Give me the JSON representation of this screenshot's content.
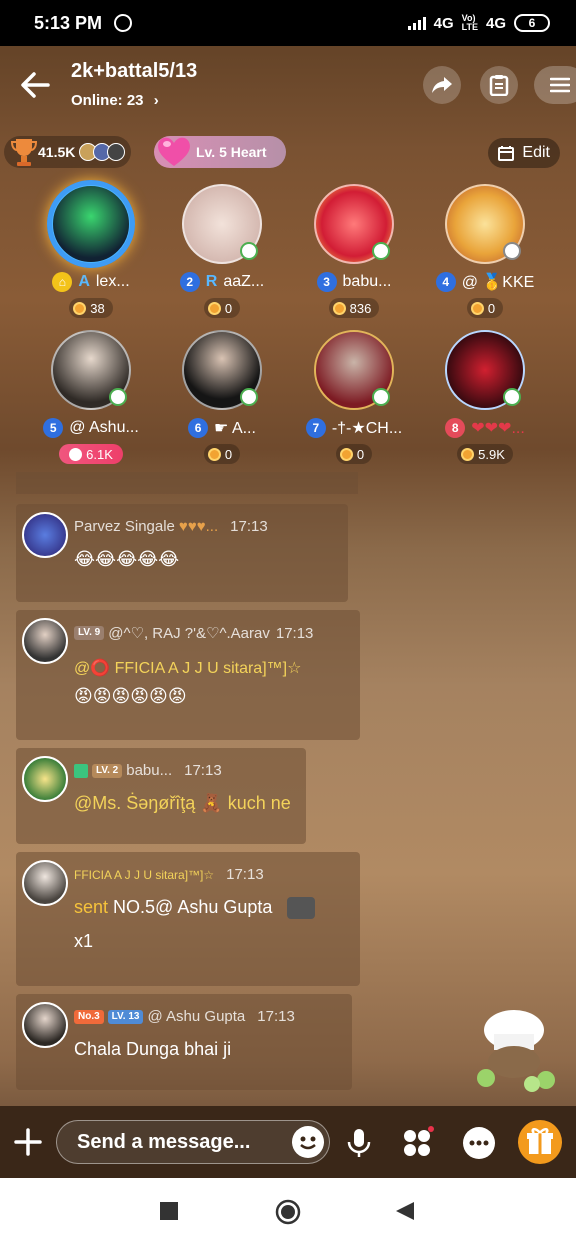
{
  "status_bar": {
    "time": "5:13 PM",
    "network_1": "4G",
    "network_2": "4G",
    "battery": "6"
  },
  "header": {
    "title": "2k+battal5/13",
    "online_label": "Online: 23",
    "icons": [
      "back-arrow-icon",
      "share-icon",
      "clipboard-icon",
      "menu-icon"
    ]
  },
  "stats": {
    "trophy_count": "41.5K",
    "heart_level": "Lv. 5 Heart",
    "edit_label": "Edit"
  },
  "seats": [
    {
      "num": "",
      "name": "lex...",
      "prefix": "A",
      "points": "38",
      "host": true
    },
    {
      "num": "2",
      "name": "aaZ...",
      "prefix": "R",
      "points": "0"
    },
    {
      "num": "3",
      "name": "babu...",
      "prefix": "",
      "points": "836"
    },
    {
      "num": "4",
      "name": "@ 🥇KKE",
      "prefix": "",
      "points": "0"
    },
    {
      "num": "5",
      "name": "@ Ashu...",
      "prefix": "",
      "points": "6.1K",
      "pink": true
    },
    {
      "num": "6",
      "name": "☛ A...",
      "prefix": "",
      "points": "0"
    },
    {
      "num": "7",
      "name": "-†-★CH...",
      "prefix": "",
      "points": "0"
    },
    {
      "num": "8",
      "name": "❤❤❤...",
      "prefix": "",
      "points": "5.9K",
      "red": true
    }
  ],
  "messages": [
    {
      "sender": "Parvez Singale",
      "time": "17:13",
      "text": "😂😂😂😂😂"
    },
    {
      "sender": "@^♡, RAJ ?'&♡^.Aarav",
      "level": "LV. 9",
      "time": "17:13",
      "text": "@⭕ FFICIA A J J U sitara]™]☆",
      "text2": "😡😡😡😡😡😡"
    },
    {
      "sender": "babu...",
      "level": "LV. 2",
      "time": "17:13",
      "text": "@Ms. Ṡәŋøřîţą 🧸 kuch ne"
    },
    {
      "sender": "FFICIA A J J U sitara]™]☆",
      "time": "17:13",
      "text": "sent NO.5@ Ashu Gupta",
      "text_prefix": "sent",
      "text_rest": " NO.5@ Ashu Gupta",
      "text2": "x1"
    },
    {
      "sender": "@ Ashu Gupta",
      "level": "LV. 13",
      "badge": "No.3",
      "time": "17:13",
      "text": "Chala Dunga bhai ji"
    }
  ],
  "input": {
    "placeholder": "Send a message..."
  },
  "colors": {
    "accent_gold": "#f3c31a",
    "seat_blue": "#2f6fe0",
    "gift_orange": "#f39a1c"
  }
}
